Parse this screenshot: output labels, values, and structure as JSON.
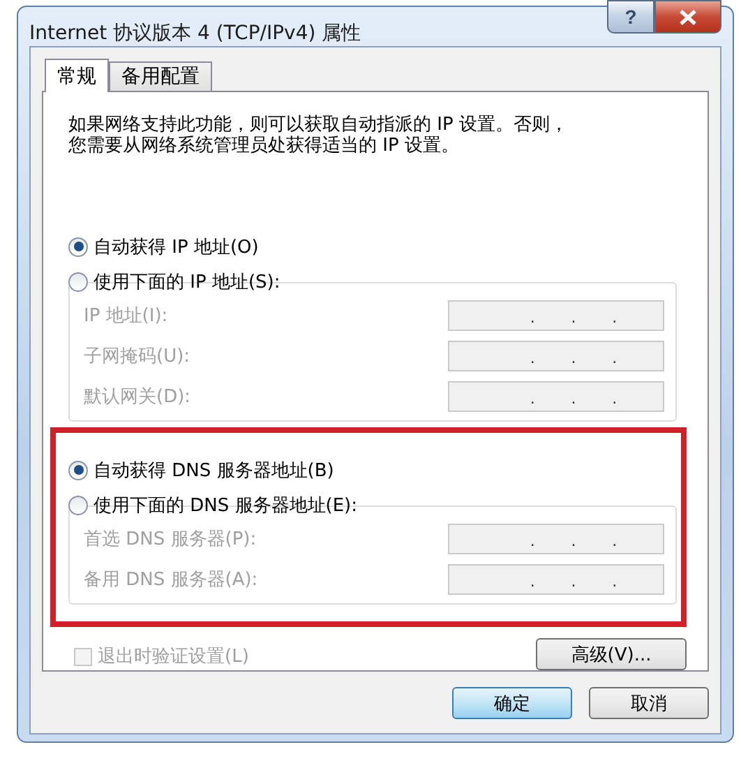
{
  "window": {
    "title": "Internet 协议版本 4 (TCP/IPv4) 属性",
    "controls": [
      {
        "kind": "help",
        "label": "?"
      },
      {
        "kind": "close"
      }
    ]
  },
  "tabs": [
    {
      "label": "常规",
      "selected": true
    },
    {
      "label": "备用配置",
      "selected": false
    }
  ],
  "description": [
    "如果网络支持此功能，则可以获取自动指派的 IP 设置。否则，",
    "您需要从网络系统管理员处获得适当的 IP 设置。"
  ],
  "sections": [
    {
      "highlighted": false,
      "options": [
        {
          "label": "自动获得 IP 地址(O)",
          "selected": true
        },
        {
          "label": "使用下面的 IP 地址(S):",
          "selected": false
        }
      ],
      "fields": [
        {
          "label": "IP 地址(I):",
          "disabled": true,
          "dots": [
            ".",
            ".",
            "."
          ]
        },
        {
          "label": "子网掩码(U):",
          "disabled": true,
          "dots": [
            ".",
            ".",
            "."
          ]
        },
        {
          "label": "默认网关(D):",
          "disabled": true,
          "dots": [
            ".",
            ".",
            "."
          ]
        }
      ]
    },
    {
      "highlighted": true,
      "options": [
        {
          "label": "自动获得 DNS 服务器地址(B)",
          "selected": true
        },
        {
          "label": "使用下面的 DNS 服务器地址(E):",
          "selected": false
        }
      ],
      "fields": [
        {
          "label": "首选 DNS 服务器(P):",
          "disabled": true,
          "dots": [
            ".",
            ".",
            "."
          ]
        },
        {
          "label": "备用 DNS 服务器(A):",
          "disabled": true,
          "dots": [
            ".",
            ".",
            "."
          ]
        }
      ]
    }
  ],
  "checkbox": {
    "label": "退出时验证设置(L)",
    "checked": false,
    "disabled": true
  },
  "advanced_button": "高级(V)...",
  "buttons": [
    {
      "label": "确定",
      "default": true
    },
    {
      "label": "取消",
      "default": false
    }
  ]
}
